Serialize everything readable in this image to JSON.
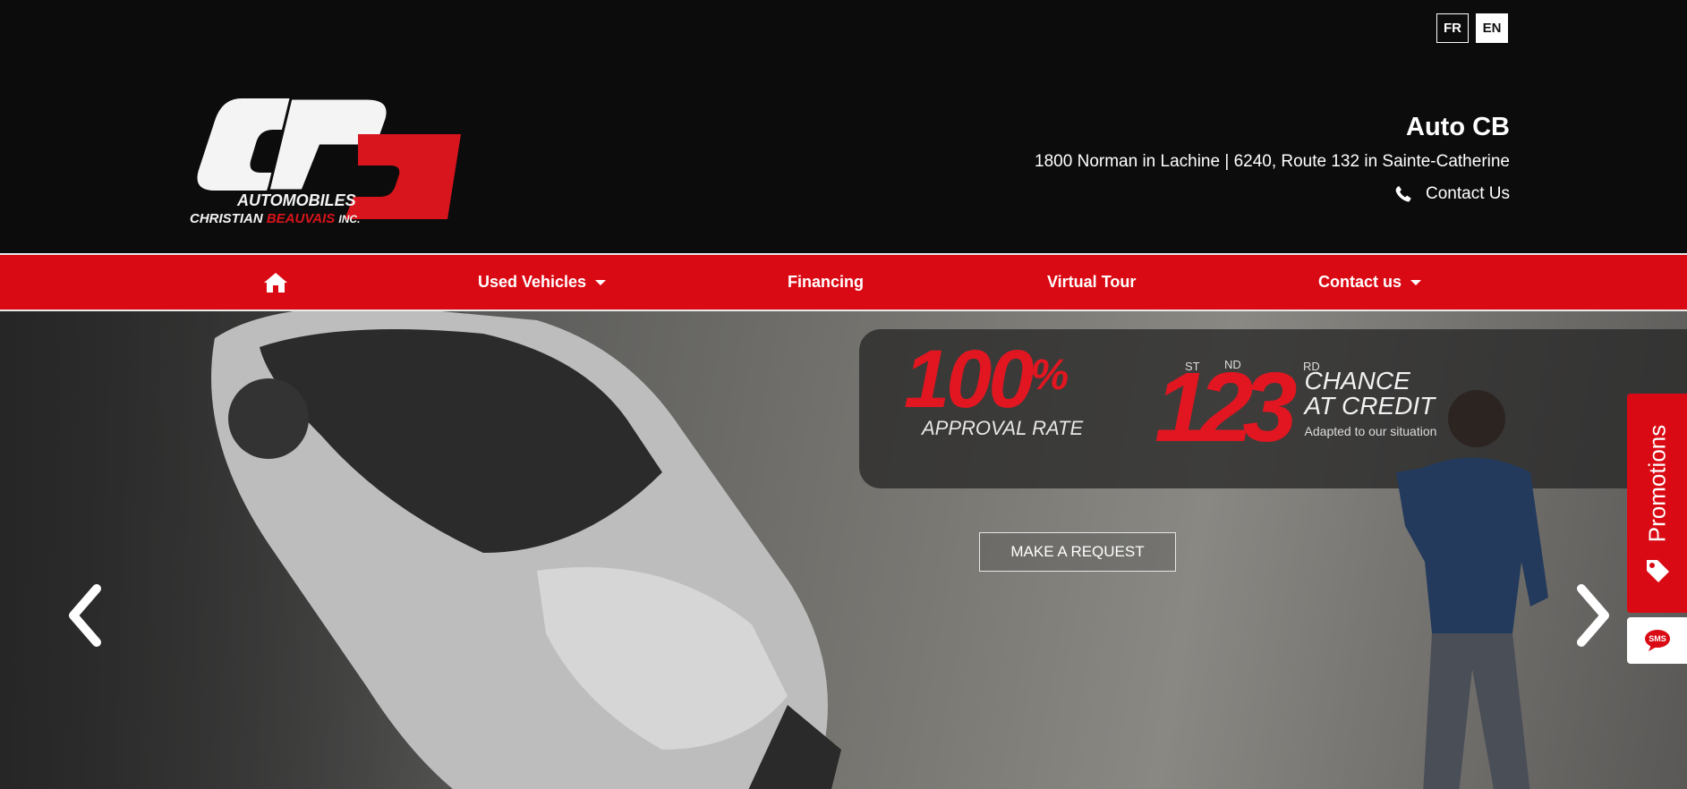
{
  "header": {
    "lang_fr": "FR",
    "lang_en": "EN",
    "logo_text": {
      "line1": "AUTOMOBILES",
      "line2_a": "CHRISTIAN",
      "line2_b": "BEAUVAIS",
      "line2_c": "INC."
    },
    "brand": "Auto CB",
    "address": "1800 Norman in Lachine | 6240, Route 132 in Sainte-Catherine",
    "contact_label": "Contact Us"
  },
  "nav": {
    "items": [
      {
        "label": "Used Vehicles"
      },
      {
        "label": "Financing"
      },
      {
        "label": "Virtual Tour"
      },
      {
        "label": "Contact us"
      }
    ]
  },
  "hero": {
    "rate_value": "100",
    "rate_unit": "%",
    "rate_label": "APPROVAL RATE",
    "chance_digits": "123",
    "ord_1": "ST",
    "ord_2": "ND",
    "ord_3": "RD",
    "chance_line1": "CHANCE",
    "chance_line2": "AT CREDIT",
    "chance_sub": "Adapted to our situation",
    "cta": "MAKE A REQUEST"
  },
  "side": {
    "promotions": "Promotions",
    "sms": "SMS"
  },
  "colors": {
    "accent": "#da0a14",
    "dark": "#0c0c0c"
  },
  "icons": [
    "phone-icon",
    "home-icon",
    "chevron-left-icon",
    "chevron-right-icon",
    "tag-icon",
    "sms-icon"
  ]
}
